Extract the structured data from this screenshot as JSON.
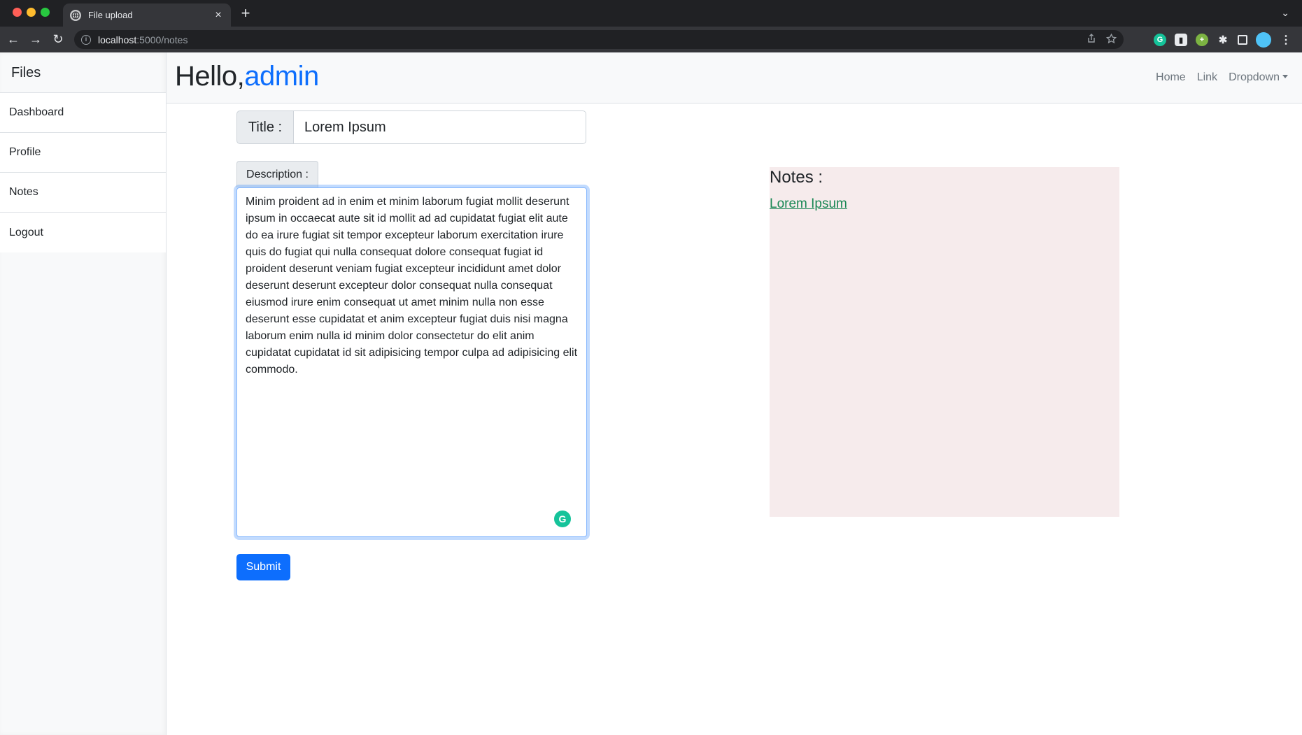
{
  "browser": {
    "tab_title": "File upload",
    "tab_close": "×",
    "new_tab": "+",
    "tab_overflow": "⌄",
    "url_host": "localhost",
    "url_path": ":5000/notes",
    "nav_back": "←",
    "nav_forward": "→",
    "nav_reload": "↻"
  },
  "sidebar": {
    "brand": "Files",
    "items": [
      {
        "label": "Dashboard"
      },
      {
        "label": "Profile"
      },
      {
        "label": "Notes"
      },
      {
        "label": "Logout"
      }
    ]
  },
  "header": {
    "greeting": "Hello,",
    "username": "admin",
    "links": [
      {
        "label": "Home"
      },
      {
        "label": "Link"
      },
      {
        "label": "Dropdown"
      }
    ]
  },
  "form": {
    "title_label": "Title :",
    "title_value": "Lorem Ipsum",
    "description_label": "Description :",
    "description_value": "Minim proident ad in enim et minim laborum fugiat mollit deserunt ipsum in occaecat aute sit id mollit ad ad cupidatat fugiat elit aute do ea irure fugiat sit tempor excepteur laborum exercitation irure quis do fugiat qui nulla consequat dolore consequat fugiat id proident deserunt veniam fugiat excepteur incididunt amet dolor deserunt deserunt excepteur dolor consequat nulla consequat eiusmod irure enim consequat ut amet minim nulla non esse deserunt esse cupidatat et anim excepteur fugiat duis nisi magna laborum enim nulla id minim dolor consectetur do elit anim cupidatat cupidatat id sit adipisicing tempor culpa ad adipisicing elit commodo.",
    "submit_label": "Submit"
  },
  "notes": {
    "heading": "Notes :",
    "items": [
      {
        "title": "Lorem Ipsum"
      }
    ]
  },
  "colors": {
    "primary": "#0d6efd",
    "note_link": "#198754",
    "notes_bg": "#f6ebec"
  }
}
